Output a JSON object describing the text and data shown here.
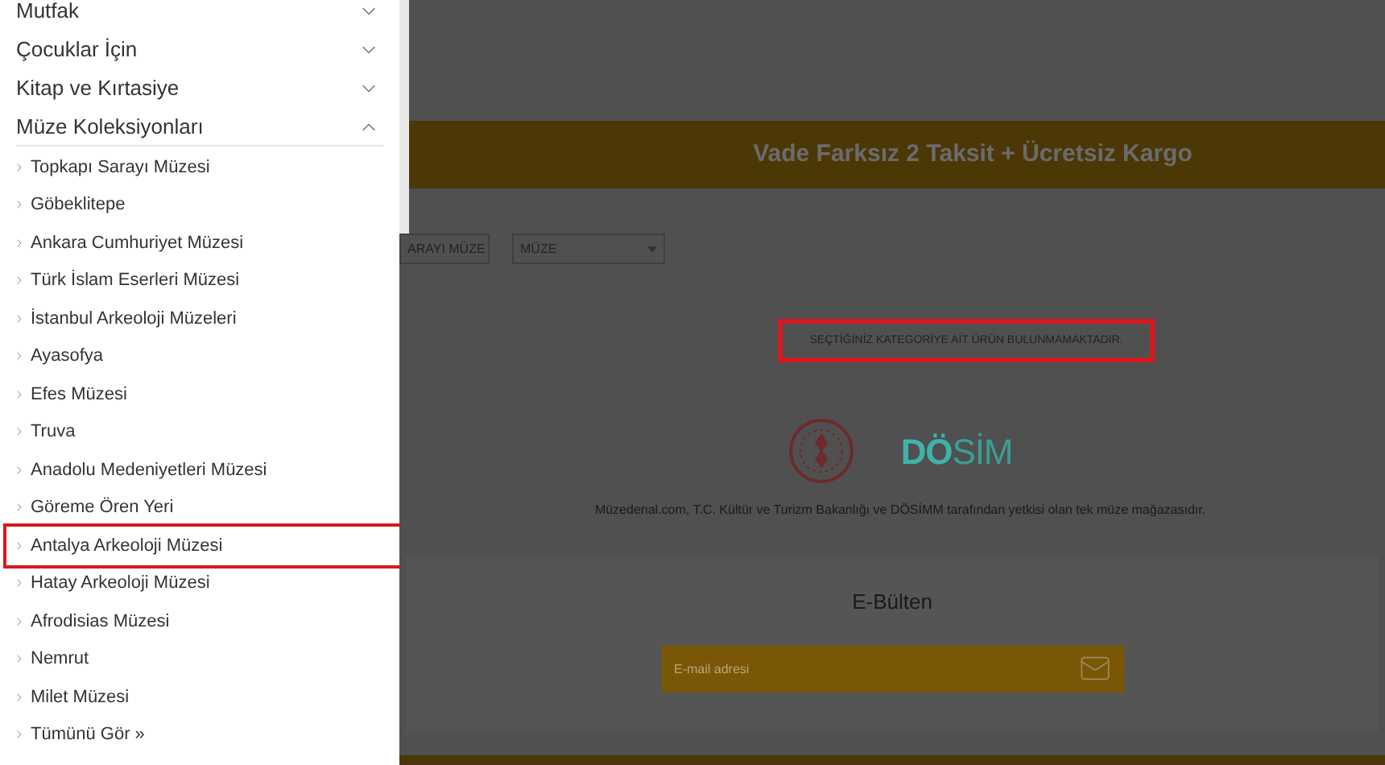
{
  "sidebar": {
    "categories": [
      {
        "label": "Mutfak",
        "expanded": false
      },
      {
        "label": "Çocuklar İçin",
        "expanded": false
      },
      {
        "label": "Kitap ve Kırtasiye",
        "expanded": false
      },
      {
        "label": "Müze Koleksiyonları",
        "expanded": true,
        "children": [
          {
            "label": "Topkapı Sarayı Müzesi",
            "highlighted": false
          },
          {
            "label": "Göbeklitepe",
            "highlighted": false
          },
          {
            "label": "Ankara Cumhuriyet Müzesi",
            "highlighted": false
          },
          {
            "label": "Türk İslam Eserleri Müzesi",
            "highlighted": false
          },
          {
            "label": "İstanbul Arkeoloji Müzeleri",
            "highlighted": false
          },
          {
            "label": "Ayasofya",
            "highlighted": false
          },
          {
            "label": "Efes Müzesi",
            "highlighted": false
          },
          {
            "label": "Truva",
            "highlighted": false
          },
          {
            "label": "Anadolu Medeniyetleri Müzesi",
            "highlighted": false
          },
          {
            "label": "Göreme Ören Yeri",
            "highlighted": false
          },
          {
            "label": "Antalya Arkeoloji Müzesi",
            "highlighted": true
          },
          {
            "label": "Hatay Arkeoloji Müzesi",
            "highlighted": false
          },
          {
            "label": "Afrodisias Müzesi",
            "highlighted": false
          },
          {
            "label": "Nemrut",
            "highlighted": false
          },
          {
            "label": "Milet Müzesi",
            "highlighted": false
          },
          {
            "label": "Tümünü Gör »",
            "highlighted": false
          }
        ]
      }
    ]
  },
  "promo_banner": "Vade Farksız 2 Taksit + Ücretsiz Kargo",
  "filters": [
    {
      "value": "ARAYI MÜZE"
    },
    {
      "value": "MÜZE"
    }
  ],
  "empty_message": {
    "text": "SEÇTİĞİNİZ KATEGORİYE AİT ÜRÜN BULUNMAMAKTADIR.",
    "highlighted": true
  },
  "partner_logo_text": "DÖSİM",
  "authorization_note": "Müzedenal.com, T.C. Kültür ve Turizm Bakanlığı ve DÖSİMM tarafından yetkisi olan tek müze mağazasıdır.",
  "newsletter": {
    "title": "E-Bülten",
    "placeholder": "E-mail adresi"
  }
}
